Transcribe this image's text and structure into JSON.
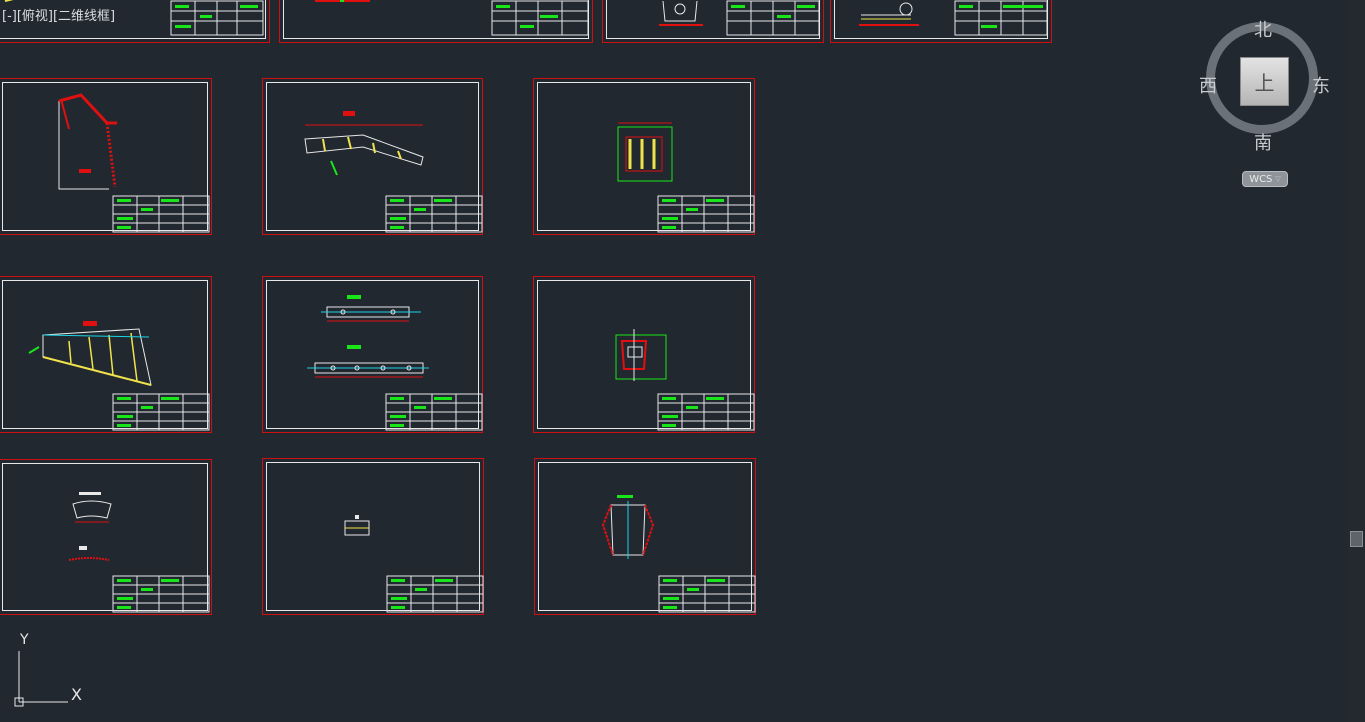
{
  "viewport": {
    "label": "[-][俯视][二维线框]"
  },
  "viewcube": {
    "north": "北",
    "south": "南",
    "east": "东",
    "west": "西",
    "top_face": "上",
    "wcs_label": "WCS",
    "wcs_arrow": "▽"
  },
  "ucs": {
    "x_label": "X",
    "y_label": "Y"
  },
  "colors": {
    "background": "#212830",
    "frame_red": "#d01010",
    "frame_white": "#e8e8e8",
    "green": "#19e619",
    "yellow": "#f0e24a",
    "red": "#e01010",
    "cyan": "#1ad5e6"
  },
  "sheets": [
    {
      "id": "row0-1"
    },
    {
      "id": "row0-2"
    },
    {
      "id": "row0-3"
    },
    {
      "id": "row0-4"
    },
    {
      "id": "row1-1"
    },
    {
      "id": "row1-2"
    },
    {
      "id": "row1-3"
    },
    {
      "id": "row2-1"
    },
    {
      "id": "row2-2"
    },
    {
      "id": "row2-3"
    },
    {
      "id": "row3-1"
    },
    {
      "id": "row3-2"
    },
    {
      "id": "row3-3"
    }
  ]
}
